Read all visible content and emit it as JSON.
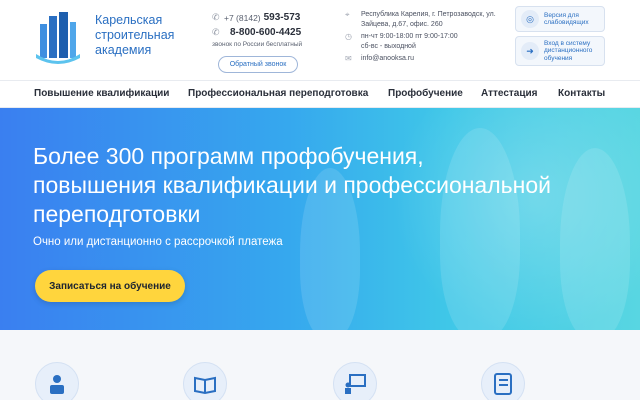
{
  "header": {
    "brand_lines": [
      "Карельская",
      "строительная",
      "академия"
    ],
    "phone_code": "+7 (8142)",
    "phone_local": "593-573",
    "phone_free": "8-800-600-4425",
    "phone_note": "звонок по России бесплатный",
    "callback_label": "Обратный звонок",
    "address": "Республика Карелия, г. Петрозаводск, ул. Зайцева, д.67, офис. 260",
    "hours_1": "пн-чт 9:00-18:00 пт 9:00-17:00",
    "hours_2": "сб-вс - выходной",
    "email": "info@anooksa.ru",
    "accessible_label": "Версия для слабовидящих",
    "login_label": "Вход в систему дистанционного обучения"
  },
  "nav": {
    "items": [
      "Повышение квалификации",
      "Профессиональная переподготовка",
      "Профобучение",
      "Аттестация",
      "Контакты"
    ]
  },
  "hero": {
    "title_line1": "Более 300 программ профобучения,",
    "title_line2": "повышения квалификации и профессиональной",
    "title_line3": "переподготовки",
    "subtitle": "Очно или дистанционно с рассрочкой платежа",
    "cta_label": "Записаться на обучение"
  },
  "features": {
    "icons": [
      "teacher-computer-icon",
      "book-icon",
      "presentation-icon",
      "checklist-icon"
    ]
  },
  "colors": {
    "brand": "#2a6fc2",
    "cta": "#ffd53d",
    "hero_start": "#3a7ff0",
    "hero_end": "#58d6e2"
  }
}
